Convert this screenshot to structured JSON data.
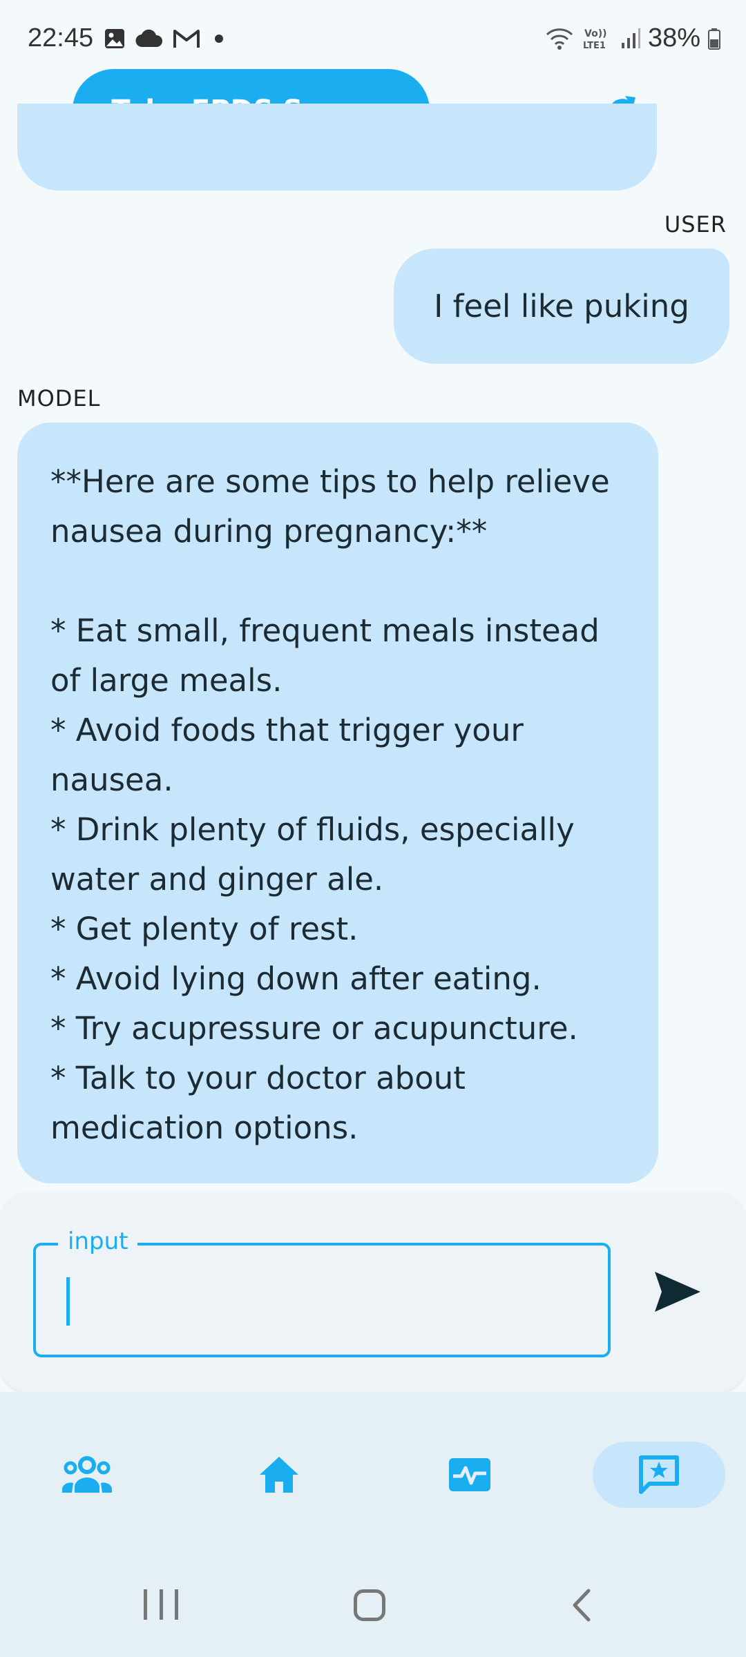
{
  "status_bar": {
    "time": "22:45",
    "battery": "38%",
    "left_icons": [
      "gallery-icon",
      "cloud-icon",
      "gmail-icon",
      "dot-icon"
    ],
    "right_icons": [
      "wifi-icon",
      "volte-icon",
      "signal-icon",
      "battery-icon"
    ]
  },
  "header": {
    "survey_button_label": "Take EPDS Survey",
    "refresh_icon": "refresh-icon"
  },
  "colors": {
    "accent": "#1aaef0",
    "bubble": "#c7e5fb",
    "background": "#f4f9fc",
    "panel": "#edf3f7",
    "nav_bg": "#e4eff6"
  },
  "chat": {
    "user_role": "USER",
    "user_message": "I feel like puking",
    "model_role": "MODEL",
    "model_message": "**Here are some tips to help relieve nausea during pregnancy:**\n\n* Eat small, frequent meals instead of large meals.\n* Avoid foods that trigger your nausea.\n* Drink plenty of fluids, especially water and ginger ale.\n* Get plenty of rest.\n* Avoid lying down after eating.\n* Try acupressure or acupuncture.\n* Talk to your doctor about medication options."
  },
  "composer": {
    "label": "input",
    "value": "",
    "send_icon": "send-icon"
  },
  "bottom_nav": {
    "items": [
      {
        "icon": "community-icon",
        "selected": false
      },
      {
        "icon": "home-icon",
        "selected": false
      },
      {
        "icon": "health-monitor-icon",
        "selected": false
      },
      {
        "icon": "chat-star-icon",
        "selected": true
      }
    ]
  }
}
